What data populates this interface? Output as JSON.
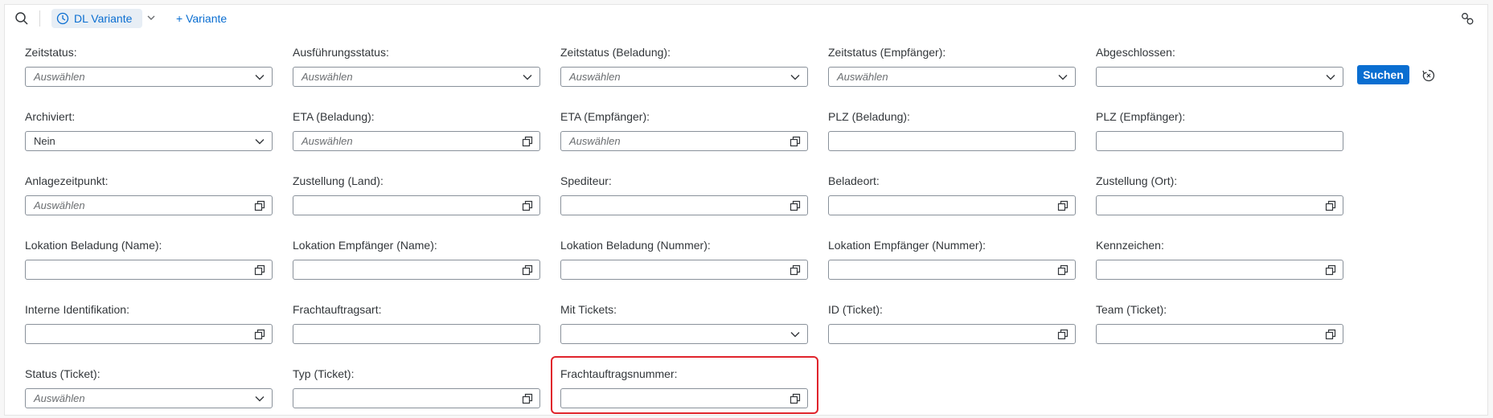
{
  "toolbar": {
    "variant_label": "DL Variante",
    "add_variant_label": "+ Variante"
  },
  "actions": {
    "search_label": "Suchen"
  },
  "fields": [
    {
      "id": "zeitstatus",
      "label": "Zeitstatus:",
      "value": "",
      "placeholder": "Auswählen",
      "control": "dropdown"
    },
    {
      "id": "ausfuehrungsstatus",
      "label": "Ausführungsstatus:",
      "value": "",
      "placeholder": "Auswählen",
      "control": "dropdown"
    },
    {
      "id": "zeitstatus-beladung",
      "label": "Zeitstatus (Beladung):",
      "value": "",
      "placeholder": "Auswählen",
      "control": "dropdown"
    },
    {
      "id": "zeitstatus-empfaenger",
      "label": "Zeitstatus (Empfänger):",
      "value": "",
      "placeholder": "Auswählen",
      "control": "dropdown"
    },
    {
      "id": "abgeschlossen",
      "label": "Abgeschlossen:",
      "value": "",
      "placeholder": "",
      "control": "dropdown"
    },
    {
      "id": "archiviert",
      "label": "Archiviert:",
      "value": "Nein",
      "placeholder": "",
      "control": "dropdown"
    },
    {
      "id": "eta-beladung",
      "label": "ETA (Beladung):",
      "value": "",
      "placeholder": "Auswählen",
      "control": "valuehelp"
    },
    {
      "id": "eta-empfaenger",
      "label": "ETA (Empfänger):",
      "value": "",
      "placeholder": "Auswählen",
      "control": "valuehelp"
    },
    {
      "id": "plz-beladung",
      "label": "PLZ (Beladung):",
      "value": "",
      "placeholder": "",
      "control": "text"
    },
    {
      "id": "plz-empfaenger",
      "label": "PLZ (Empfänger):",
      "value": "",
      "placeholder": "",
      "control": "text"
    },
    {
      "id": "anlagezeitpunkt",
      "label": "Anlagezeitpunkt:",
      "value": "",
      "placeholder": "Auswählen",
      "control": "valuehelp"
    },
    {
      "id": "zustellung-land",
      "label": "Zustellung (Land):",
      "value": "",
      "placeholder": "",
      "control": "valuehelp"
    },
    {
      "id": "spediteur",
      "label": "Spediteur:",
      "value": "",
      "placeholder": "",
      "control": "valuehelp"
    },
    {
      "id": "beladeort",
      "label": "Beladeort:",
      "value": "",
      "placeholder": "",
      "control": "valuehelp"
    },
    {
      "id": "zustellung-ort",
      "label": "Zustellung (Ort):",
      "value": "",
      "placeholder": "",
      "control": "valuehelp"
    },
    {
      "id": "lokation-beladung-name",
      "label": "Lokation Beladung (Name):",
      "value": "",
      "placeholder": "",
      "control": "valuehelp"
    },
    {
      "id": "lokation-empfaenger-name",
      "label": "Lokation Empfänger (Name):",
      "value": "",
      "placeholder": "",
      "control": "valuehelp"
    },
    {
      "id": "lokation-beladung-nummer",
      "label": "Lokation Beladung (Nummer):",
      "value": "",
      "placeholder": "",
      "control": "valuehelp"
    },
    {
      "id": "lokation-empfaenger-nummer",
      "label": "Lokation Empfänger (Nummer):",
      "value": "",
      "placeholder": "",
      "control": "valuehelp"
    },
    {
      "id": "kennzeichen",
      "label": "Kennzeichen:",
      "value": "",
      "placeholder": "",
      "control": "valuehelp"
    },
    {
      "id": "interne-identifikation",
      "label": "Interne Identifikation:",
      "value": "",
      "placeholder": "",
      "control": "valuehelp"
    },
    {
      "id": "frachtauftragsart",
      "label": "Frachtauftragsart:",
      "value": "",
      "placeholder": "",
      "control": "text"
    },
    {
      "id": "mit-tickets",
      "label": "Mit Tickets:",
      "value": "",
      "placeholder": "",
      "control": "dropdown"
    },
    {
      "id": "id-ticket",
      "label": "ID (Ticket):",
      "value": "",
      "placeholder": "",
      "control": "valuehelp"
    },
    {
      "id": "team-ticket",
      "label": "Team (Ticket):",
      "value": "",
      "placeholder": "",
      "control": "valuehelp"
    },
    {
      "id": "status-ticket",
      "label": "Status (Ticket):",
      "value": "",
      "placeholder": "Auswählen",
      "control": "dropdown"
    },
    {
      "id": "typ-ticket",
      "label": "Typ (Ticket):",
      "value": "",
      "placeholder": "",
      "control": "valuehelp"
    },
    {
      "id": "frachtauftragsnummer",
      "label": "Frachtauftragsnummer:",
      "value": "",
      "placeholder": "",
      "control": "valuehelp"
    }
  ],
  "colors": {
    "accent": "#0a6ed1",
    "highlight": "#e0242c",
    "border": "#89919a"
  }
}
